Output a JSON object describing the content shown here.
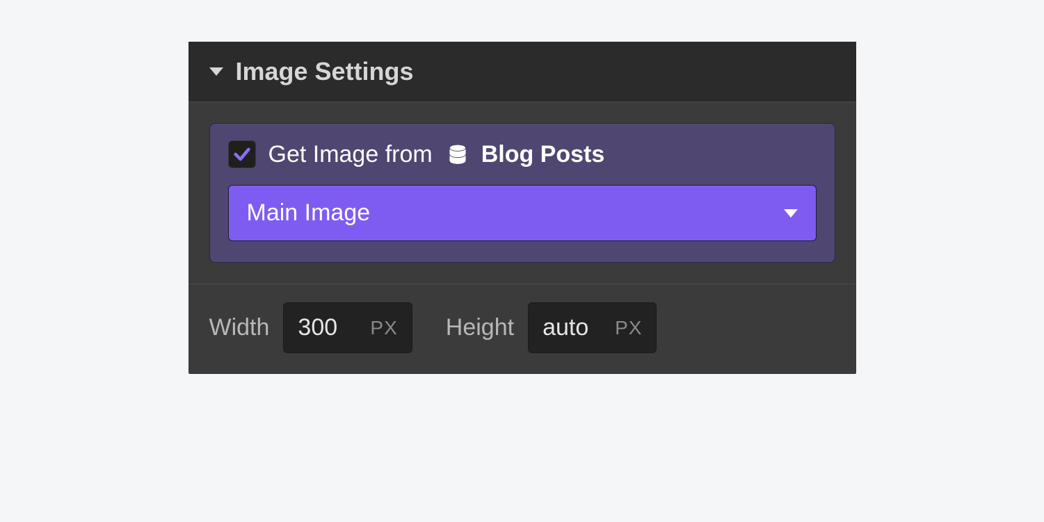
{
  "panel": {
    "title": "Image Settings"
  },
  "binding": {
    "checked": true,
    "label_prefix": "Get Image from",
    "source_name": "Blog Posts",
    "selected_field": "Main Image"
  },
  "dimensions": {
    "width_label": "Width",
    "width_value": "300",
    "width_unit": "PX",
    "height_label": "Height",
    "height_value": "auto",
    "height_unit": "PX"
  },
  "colors": {
    "accent": "#7f5cf1",
    "binding_bg": "#4f4771",
    "panel_bg": "#3b3b3b",
    "header_bg": "#2b2b2b"
  }
}
